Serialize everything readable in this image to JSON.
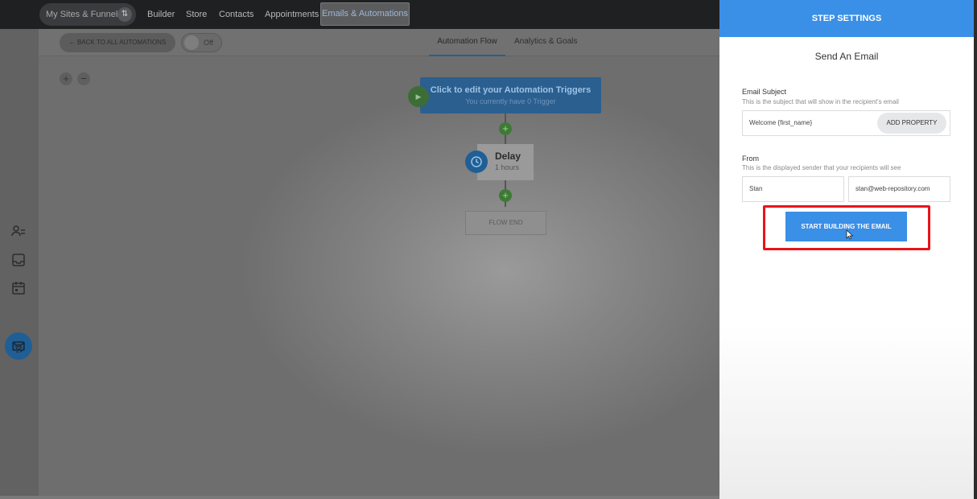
{
  "topnav": {
    "sites_label": "My Sites & Funnels",
    "switch_glyph": "⇅",
    "items": [
      "Builder",
      "Store",
      "Contacts",
      "Appointments"
    ],
    "active_item": "Emails & Automations"
  },
  "subbar": {
    "back_label": "← BACK TO ALL AUTOMATIONS",
    "toggle_label": "Off",
    "tabs": [
      "Automation Flow",
      "Analytics & Goals"
    ]
  },
  "canvas": {
    "zoom_in": "+",
    "zoom_out": "−",
    "trigger_title": "Click to edit your Automation Triggers",
    "trigger_subtitle": "You currently have 0 Trigger",
    "delay_title": "Delay",
    "delay_subtitle": "1 hours",
    "flow_end": "FLOW END",
    "add_glyph": "+",
    "play_glyph": "▶"
  },
  "sidebar": {
    "icons": [
      "contacts-icon",
      "inbox-icon",
      "calendar-icon",
      "mail-icon",
      "settings-icon"
    ],
    "active": "mail-icon"
  },
  "panel": {
    "header": "STEP SETTINGS",
    "title": "Send An Email",
    "subject_label": "Email Subject",
    "subject_hint": "This is the subject that will show in the recipient's email",
    "subject_value": "Welcome {first_name}",
    "add_property": "ADD PROPERTY",
    "from_label": "From",
    "from_hint": "This is the displayed sender that your recipients will see",
    "from_name": "Stan",
    "from_email": "stan@web-repository.com",
    "start_button": "START BUILDING THE EMAIL"
  },
  "colors": {
    "accent": "#3a8fe6",
    "highlight": "#e8141a",
    "topnav_bg": "#1f2022"
  }
}
